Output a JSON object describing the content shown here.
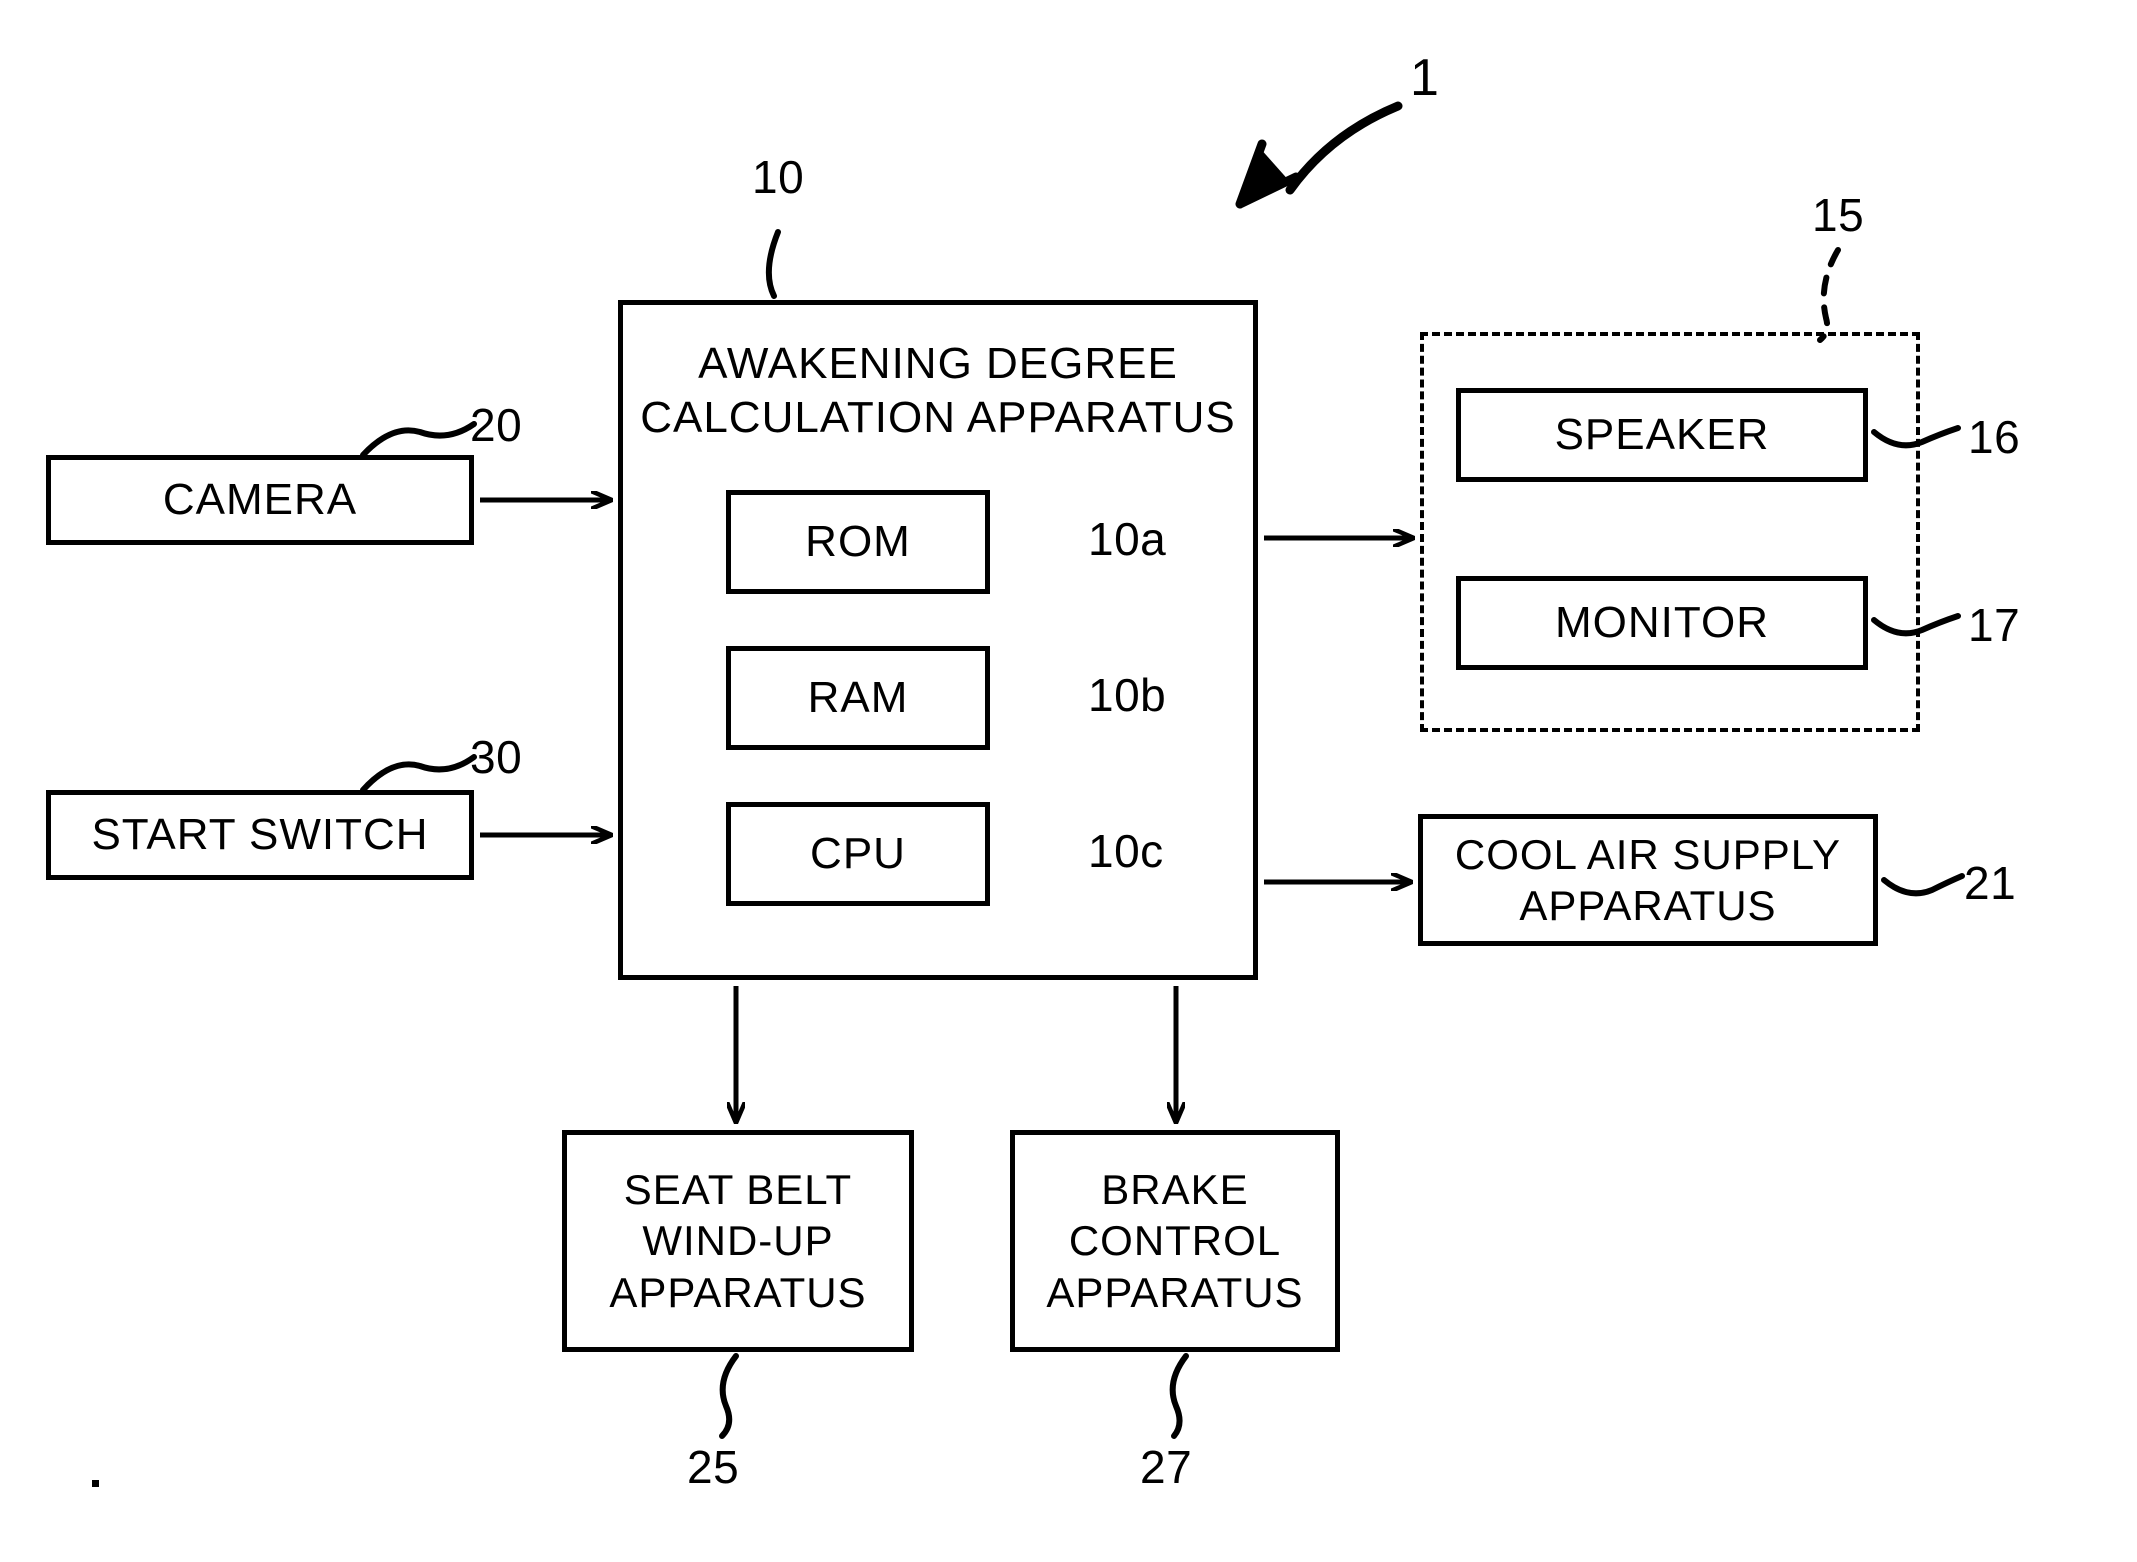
{
  "figure": {
    "type": "patent-block-diagram",
    "title": "Awakening degree calculation system block diagram",
    "system_ref": "1"
  },
  "blocks": {
    "main": {
      "label": "AWAKENING DEGREE\nCALCULATION APPARATUS",
      "ref": "10"
    },
    "rom": {
      "label": "ROM",
      "ref": "10a"
    },
    "ram": {
      "label": "RAM",
      "ref": "10b"
    },
    "cpu": {
      "label": "CPU",
      "ref": "10c"
    },
    "camera": {
      "label": "CAMERA",
      "ref": "20"
    },
    "start_switch": {
      "label": "START SWITCH",
      "ref": "30"
    },
    "speaker": {
      "label": "SPEAKER",
      "ref": "16"
    },
    "monitor": {
      "label": "MONITOR",
      "ref": "17"
    },
    "notification_group": {
      "label": "",
      "ref": "15"
    },
    "cool_air": {
      "label": "COOL AIR SUPPLY\nAPPARATUS",
      "ref": "21"
    },
    "seat_belt": {
      "label": "SEAT BELT\nWIND-UP\nAPPARATUS",
      "ref": "25"
    },
    "brake": {
      "label": "BRAKE\nCONTROL\nAPPARATUS",
      "ref": "27"
    }
  },
  "connections": [
    {
      "from": "camera",
      "to": "main",
      "style": "solid-arrow"
    },
    {
      "from": "start_switch",
      "to": "main",
      "style": "solid-arrow"
    },
    {
      "from": "main",
      "to": "notification_group",
      "style": "solid-arrow"
    },
    {
      "from": "main",
      "to": "cool_air",
      "style": "solid-arrow"
    },
    {
      "from": "main",
      "to": "seat_belt",
      "style": "solid-arrow"
    },
    {
      "from": "main",
      "to": "brake",
      "style": "solid-arrow"
    }
  ],
  "colors": {
    "line": "#000000",
    "background": "#ffffff",
    "text": "#000000"
  }
}
